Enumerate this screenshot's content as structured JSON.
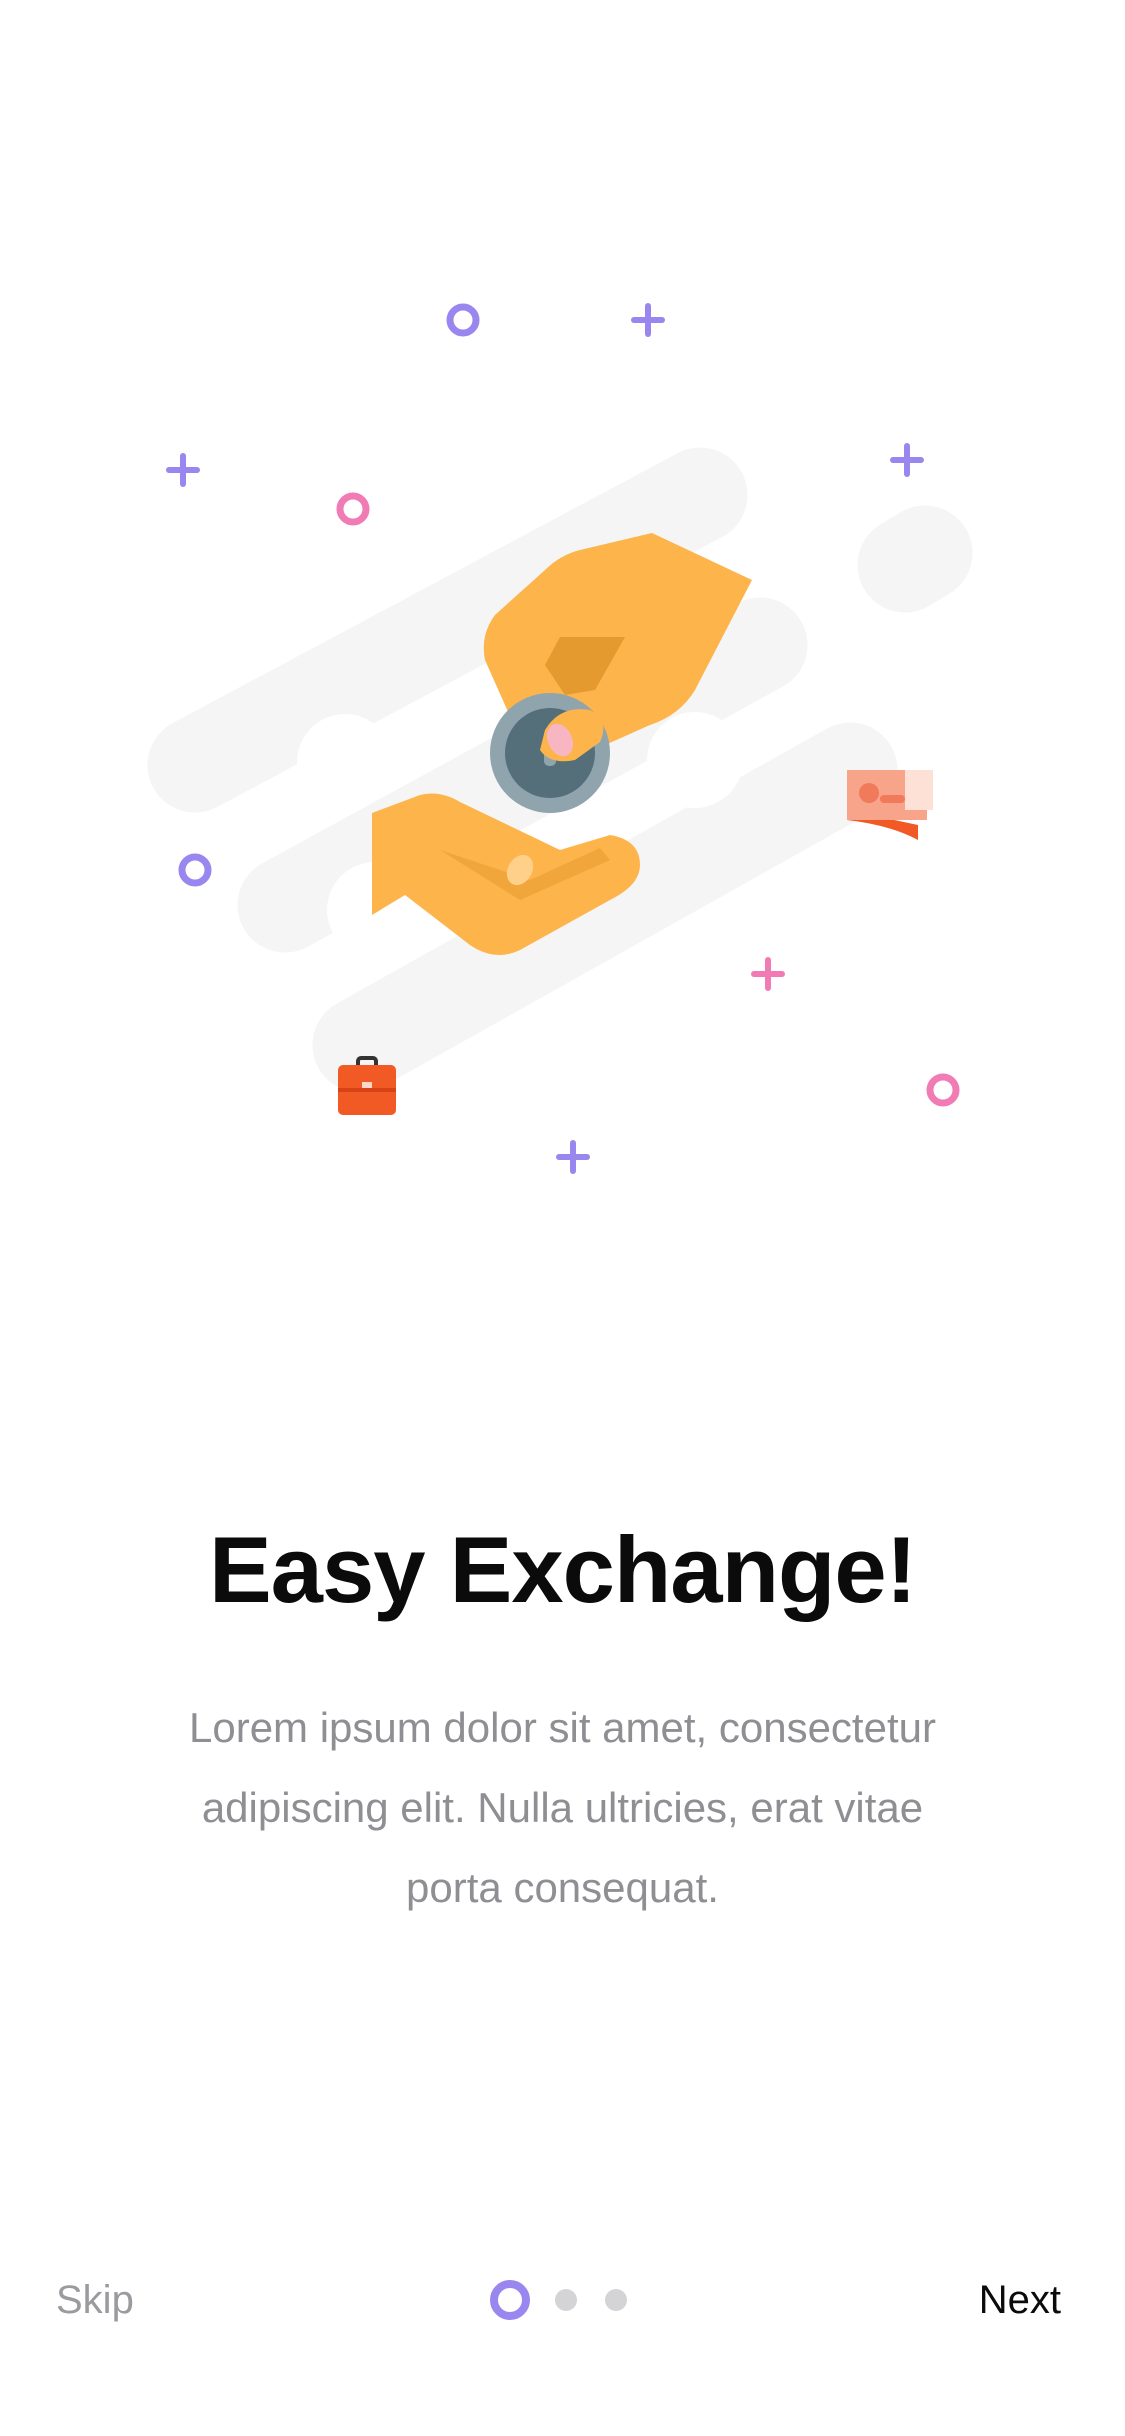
{
  "onboarding": {
    "title": "Easy Exchange!",
    "description": "Lorem ipsum dolor sit amet, consectetur adipiscing elit. Nulla ultricies, erat vitae porta consequat."
  },
  "navigation": {
    "skip_label": "Skip",
    "next_label": "Next",
    "page_count": 3,
    "current_page": 1
  },
  "illustration": {
    "icons": [
      "hand-giving-icon",
      "coin-icon",
      "hand-receiving-icon",
      "briefcase-icon",
      "banknote-icon",
      "sparkle-icon",
      "ring-icon"
    ]
  },
  "colors": {
    "accent_purple": "#9a86ef",
    "accent_pink": "#f07bb5",
    "hand_yellow": "#fdb44b",
    "coin_gray": "#546e7a",
    "briefcase_orange": "#f15a24",
    "dot_inactive": "#d4d4d6"
  }
}
